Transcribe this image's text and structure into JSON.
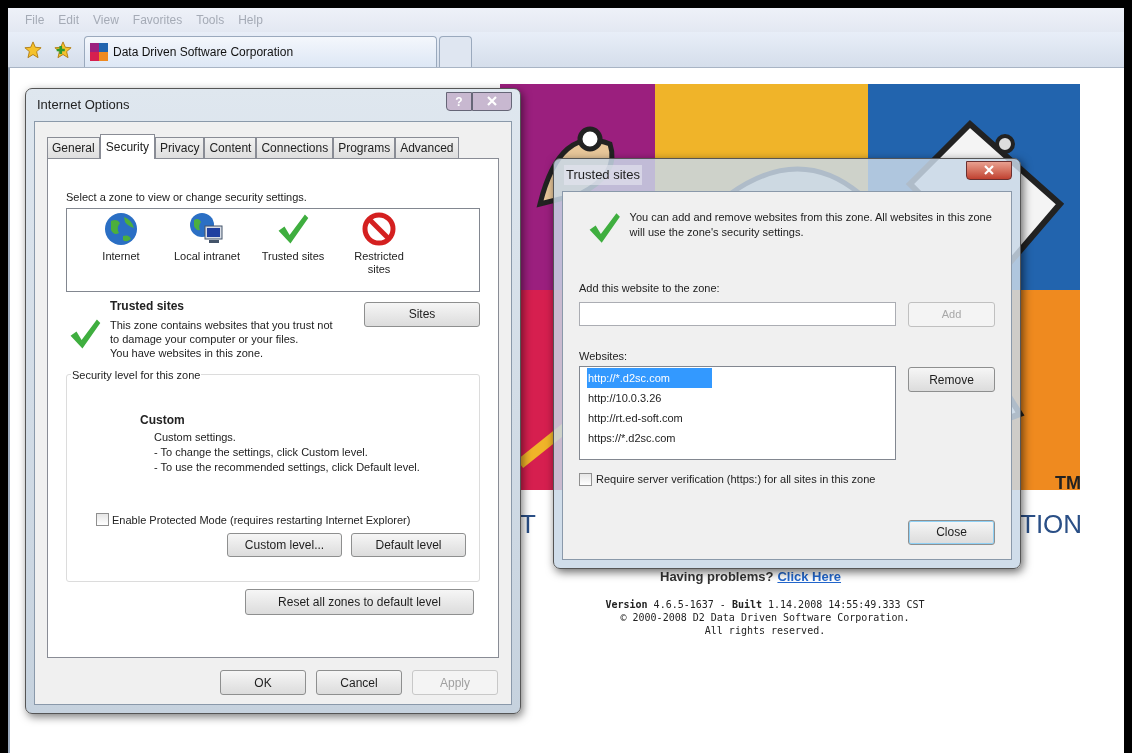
{
  "browser": {
    "menu": [
      {
        "label": "File"
      },
      {
        "label": "Edit"
      },
      {
        "label": "View"
      },
      {
        "label": "Favorites"
      },
      {
        "label": "Tools"
      },
      {
        "label": "Help"
      }
    ],
    "tab_title": "Data Driven Software Corporation"
  },
  "page": {
    "logo_mark": "TM",
    "banner_left": "T",
    "banner_right": "TION",
    "help_text": "Having problems?",
    "help_link": "Click Here",
    "version_lines": [
      "**Version** 4.6.5-1637 - **Built** 1.14.2008 14:55:49.333 CST",
      "© 2000-2008 D2 Data Driven Software Corporation.",
      "All rights reserved."
    ]
  },
  "internet_options": {
    "title": "Internet Options",
    "help_button": "?",
    "tabs": [
      {
        "label": "General",
        "selected": false
      },
      {
        "label": "Security",
        "selected": true
      },
      {
        "label": "Privacy",
        "selected": false
      },
      {
        "label": "Content",
        "selected": false
      },
      {
        "label": "Connections",
        "selected": false
      },
      {
        "label": "Programs",
        "selected": false
      },
      {
        "label": "Advanced",
        "selected": false
      }
    ],
    "zone_prompt": "Select a zone to view or change security settings.",
    "zones": [
      {
        "kind": "internet",
        "label": "Internet"
      },
      {
        "kind": "intranet",
        "label": "Local intranet"
      },
      {
        "kind": "trusted",
        "label": "Trusted sites"
      },
      {
        "kind": "restricted",
        "label": "Restricted sites"
      }
    ],
    "zone_title": "Trusted sites",
    "zone_description": "This zone contains websites that you trust not to damage your computer or your files.",
    "zone_status": "You have websites in this zone.",
    "sites_button": "Sites",
    "level_group": "Security level for this zone",
    "level_name": "Custom",
    "level_lines": [
      "Custom settings.",
      "- To change the settings, click Custom level.",
      "- To use the recommended settings, click Default level."
    ],
    "protected_mode": {
      "label": "Enable Protected Mode (requires restarting Internet Explorer)",
      "checked": false
    },
    "level_buttons": [
      "Custom level...",
      "Default level"
    ],
    "reset_button": "Reset all zones to default level",
    "footer_buttons": [
      {
        "label": "OK",
        "disabled": false
      },
      {
        "label": "Cancel",
        "disabled": false
      },
      {
        "label": "Apply",
        "disabled": true
      }
    ]
  },
  "trusted_sites": {
    "title": "Trusted sites",
    "intro": "You can add and remove websites from this zone. All websites in this zone will use the zone's security settings.",
    "add_label": "Add this website to the zone:",
    "add_button": {
      "label": "Add",
      "disabled": true
    },
    "websites_label": "Websites:",
    "websites": [
      {
        "url": "http://*.d2sc.com",
        "selected": true
      },
      {
        "url": "http://10.0.3.26",
        "selected": false
      },
      {
        "url": "http://rt.ed-soft.com",
        "selected": false
      },
      {
        "url": "https://*.d2sc.com",
        "selected": false
      }
    ],
    "remove_button": "Remove",
    "require_https": {
      "label": "Require server verification (https:) for all sites in this zone",
      "checked": false
    },
    "close_button": "Close"
  }
}
